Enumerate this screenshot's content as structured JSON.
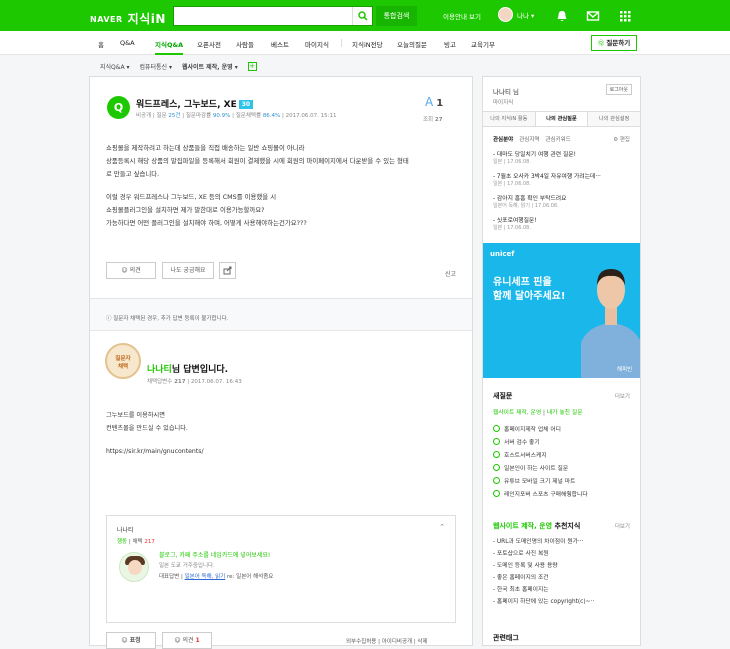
{
  "header": {
    "logo_naver": "NAVER",
    "logo_service": "지식iN",
    "search_placeholder": "",
    "total_search_label": "통합검색",
    "guide_label": "이용안내 보기",
    "user_label": "나나 ▾"
  },
  "nav": {
    "items": [
      "홈",
      "Q&A",
      "지식Q&A",
      "오픈사전",
      "사람들",
      "베스트",
      "마이지식",
      "지식iN전당",
      "오늘의질문",
      "빙고",
      "교육기부"
    ],
    "ask_label": "질문하기"
  },
  "breadcrumb": {
    "level1": "지식Q&A ▾",
    "level2": "컴퓨터통신 ▾",
    "level3": "웹사이트 제작, 운영 ▾",
    "plus": "+"
  },
  "question": {
    "title": "워드프레스, 그누보드, XE",
    "badge": "30",
    "author": "비공개",
    "q_count_label": "질문",
    "q_count": "25건",
    "resolve_label": "질문마감률",
    "resolve": "90.9%",
    "adopt_label": "질문채택률",
    "adopt": "86.4%",
    "date": "2017.06.07. 15:11",
    "answer_count_prefix": "A",
    "answer_count": "1",
    "views_label": "조회",
    "views": "27",
    "body1": "쇼핑몰을 제작하려고 하는데 상품들을 직접 배송하는 일반 쇼핑몰이 아니라",
    "body2": "상품등록시 해당 상품의 말집파일을 등록해서 회원이 결제했을 시에 회원의 마이페이지에서 다운받을 수 있는 형태",
    "body3": "로 만들고 싶습니다.",
    "body4": "이럴 경우 워드프레스나 그누보드, XE 등의 CMS를 이용했을 시",
    "body5": "쇼핑몰플러그인을 설치하면 제가 말한대로 이용가능할까요?",
    "body6": "가능하다면 어떤 플러그인을 설치해야 하며, 어떻게 사용해야하는건가요???",
    "comment_label": "의견",
    "curious_label": "나도 궁금해요",
    "report_label": "신고",
    "notice": "질문자 채택된 경우, 추가 답변 등록이 불가합니다."
  },
  "answer": {
    "medal_line1": "질문자",
    "medal_line2": "채택",
    "author_name": "나나티",
    "title_suffix": "님 답변입니다.",
    "meta_label": "채택답변수",
    "meta_count": "217",
    "date": "2017.06.07. 16:43",
    "body1": "그누보드를 이용하시면",
    "body2": "컨텐츠몰을 만드실 수 있습니다.",
    "body3": "https://sir.kr/main/gnucontents/",
    "profile_name": "나나티",
    "profile_caret": "⌃",
    "profile_field": "행동",
    "profile_adopt_label": "채택",
    "profile_adopt": "217",
    "profile_msg": "블로그, 카페 주소를 네임카드에 넣어보세요!",
    "profile_sub": "일본 도쿄 거주중입니다.",
    "profile_rep_label": "대표답변",
    "profile_rep_link": "일본어 독해, 읽기",
    "profile_rep_tail": "re: 일본어 해석좀요",
    "like_label": "표정",
    "comment_label": "의견",
    "comment_count": "1",
    "foot": "외부수집허용 | 아이디비공개 | 삭제"
  },
  "sidebar": {
    "user": "나나티 님",
    "mypage": "마이지식",
    "logout": "로그아웃",
    "tabs": [
      "나의 지식iN 활동",
      "나의 관심질문",
      "나의 관심설정"
    ],
    "sub1": "관심분야",
    "sub2": "관심지역",
    "sub3": "관심키워드",
    "edit": "편집",
    "interest": [
      {
        "t": "- 대마도 당일치기 여행 관련 질문!",
        "d": "일본 | 17.06.08."
      },
      {
        "t": "- 7월초 오사카 3박4일 자유여행 가려는데···",
        "d": "일본 | 17.06.08."
      },
      {
        "t": "- 감아지 흠흠 확인 부탁드려요",
        "d": "일본어 독해, 읽기 | 17.06.08."
      },
      {
        "t": "- 싯포로여행질문!",
        "d": "일본 | 17.06.08."
      }
    ],
    "ad_brand": "unicef",
    "ad_line1": "유니세프 핀을",
    "ad_line2": "함께 달아주세요!",
    "ad_name": "해피빈",
    "newq_title": "새질문",
    "newq_more": "더보기",
    "newq_cat": "웹사이트 제작, 운영",
    "newq_cat_tail": "내가 놓친 질문",
    "newq": [
      "홈페이지제작 업체 어디",
      "서버 검수 좋기",
      "호스트서버스케지",
      "일본인이 하는 사이트 질문",
      "유튜브 모바일 크기 제널 마트",
      "레인지포버 스포츠 구매해줭합니다"
    ],
    "rec_title_green": "웹사이트 제작, 운영",
    "rec_title_tail": "추천지식",
    "rec_more": "더보기",
    "rec": [
      "- URL과 도메인명의 차이점이 뭔가···",
      "- 포토샵으로 사진 복원",
      "- 도메인 등록 및 사용 용량",
      "- 좋은 홈페이지의 조건",
      "- 한국 최초 홈페이지는",
      "- 홈페이지 하단에 있는 copyright(c)~··"
    ],
    "tags_title": "관련태그"
  },
  "colors": {
    "brand": "#1ec800",
    "accent_blue": "#2e8fcf",
    "unicef": "#1ab7ea"
  }
}
